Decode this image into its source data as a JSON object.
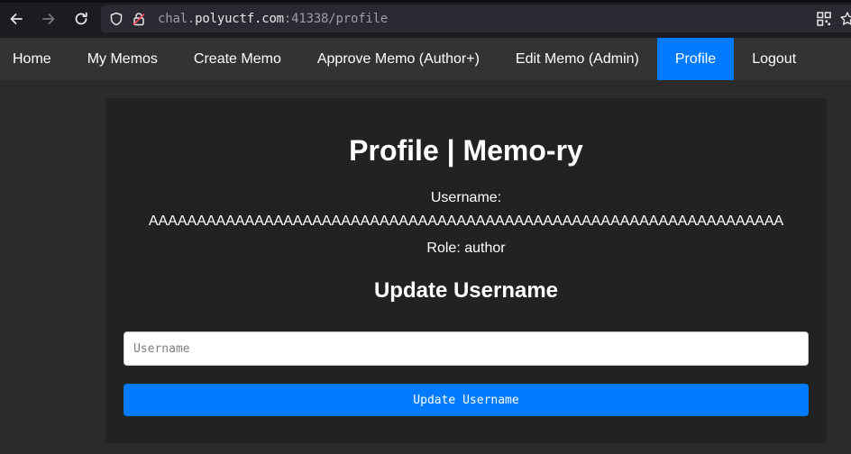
{
  "browser": {
    "url_prefix": "chal.",
    "url_host": "polyuctf.com",
    "url_rest": ":41338/profile"
  },
  "nav": {
    "items": [
      {
        "label": "Home"
      },
      {
        "label": "My Memos"
      },
      {
        "label": "Create Memo"
      },
      {
        "label": "Approve Memo (Author+)"
      },
      {
        "label": "Edit Memo (Admin)"
      },
      {
        "label": "Profile",
        "active": true
      },
      {
        "label": "Logout"
      }
    ]
  },
  "profile": {
    "title": "Profile | Memo-ry",
    "username_label": "Username:",
    "username_value": "AAAAAAAAAAAAAAAAAAAAAAAAAAAAAAAAAAAAAAAAAAAAAAAAAAAAAAAAAAAAAAAAAA",
    "role_text": "Role: author",
    "update_heading": "Update Username",
    "username_placeholder": "Username",
    "submit_label": "Update Username"
  },
  "colors": {
    "accent": "#007bff",
    "navbar": "#333333",
    "card": "#222222",
    "page_bg": "#2b2b2b"
  },
  "icons": {
    "back": "arrow-left-icon",
    "forward": "arrow-right-icon",
    "reload": "reload-icon",
    "tracking": "shield-icon",
    "connection": "insecure-lock-icon",
    "qr": "qr-code-icon",
    "bookmark": "star-icon"
  }
}
